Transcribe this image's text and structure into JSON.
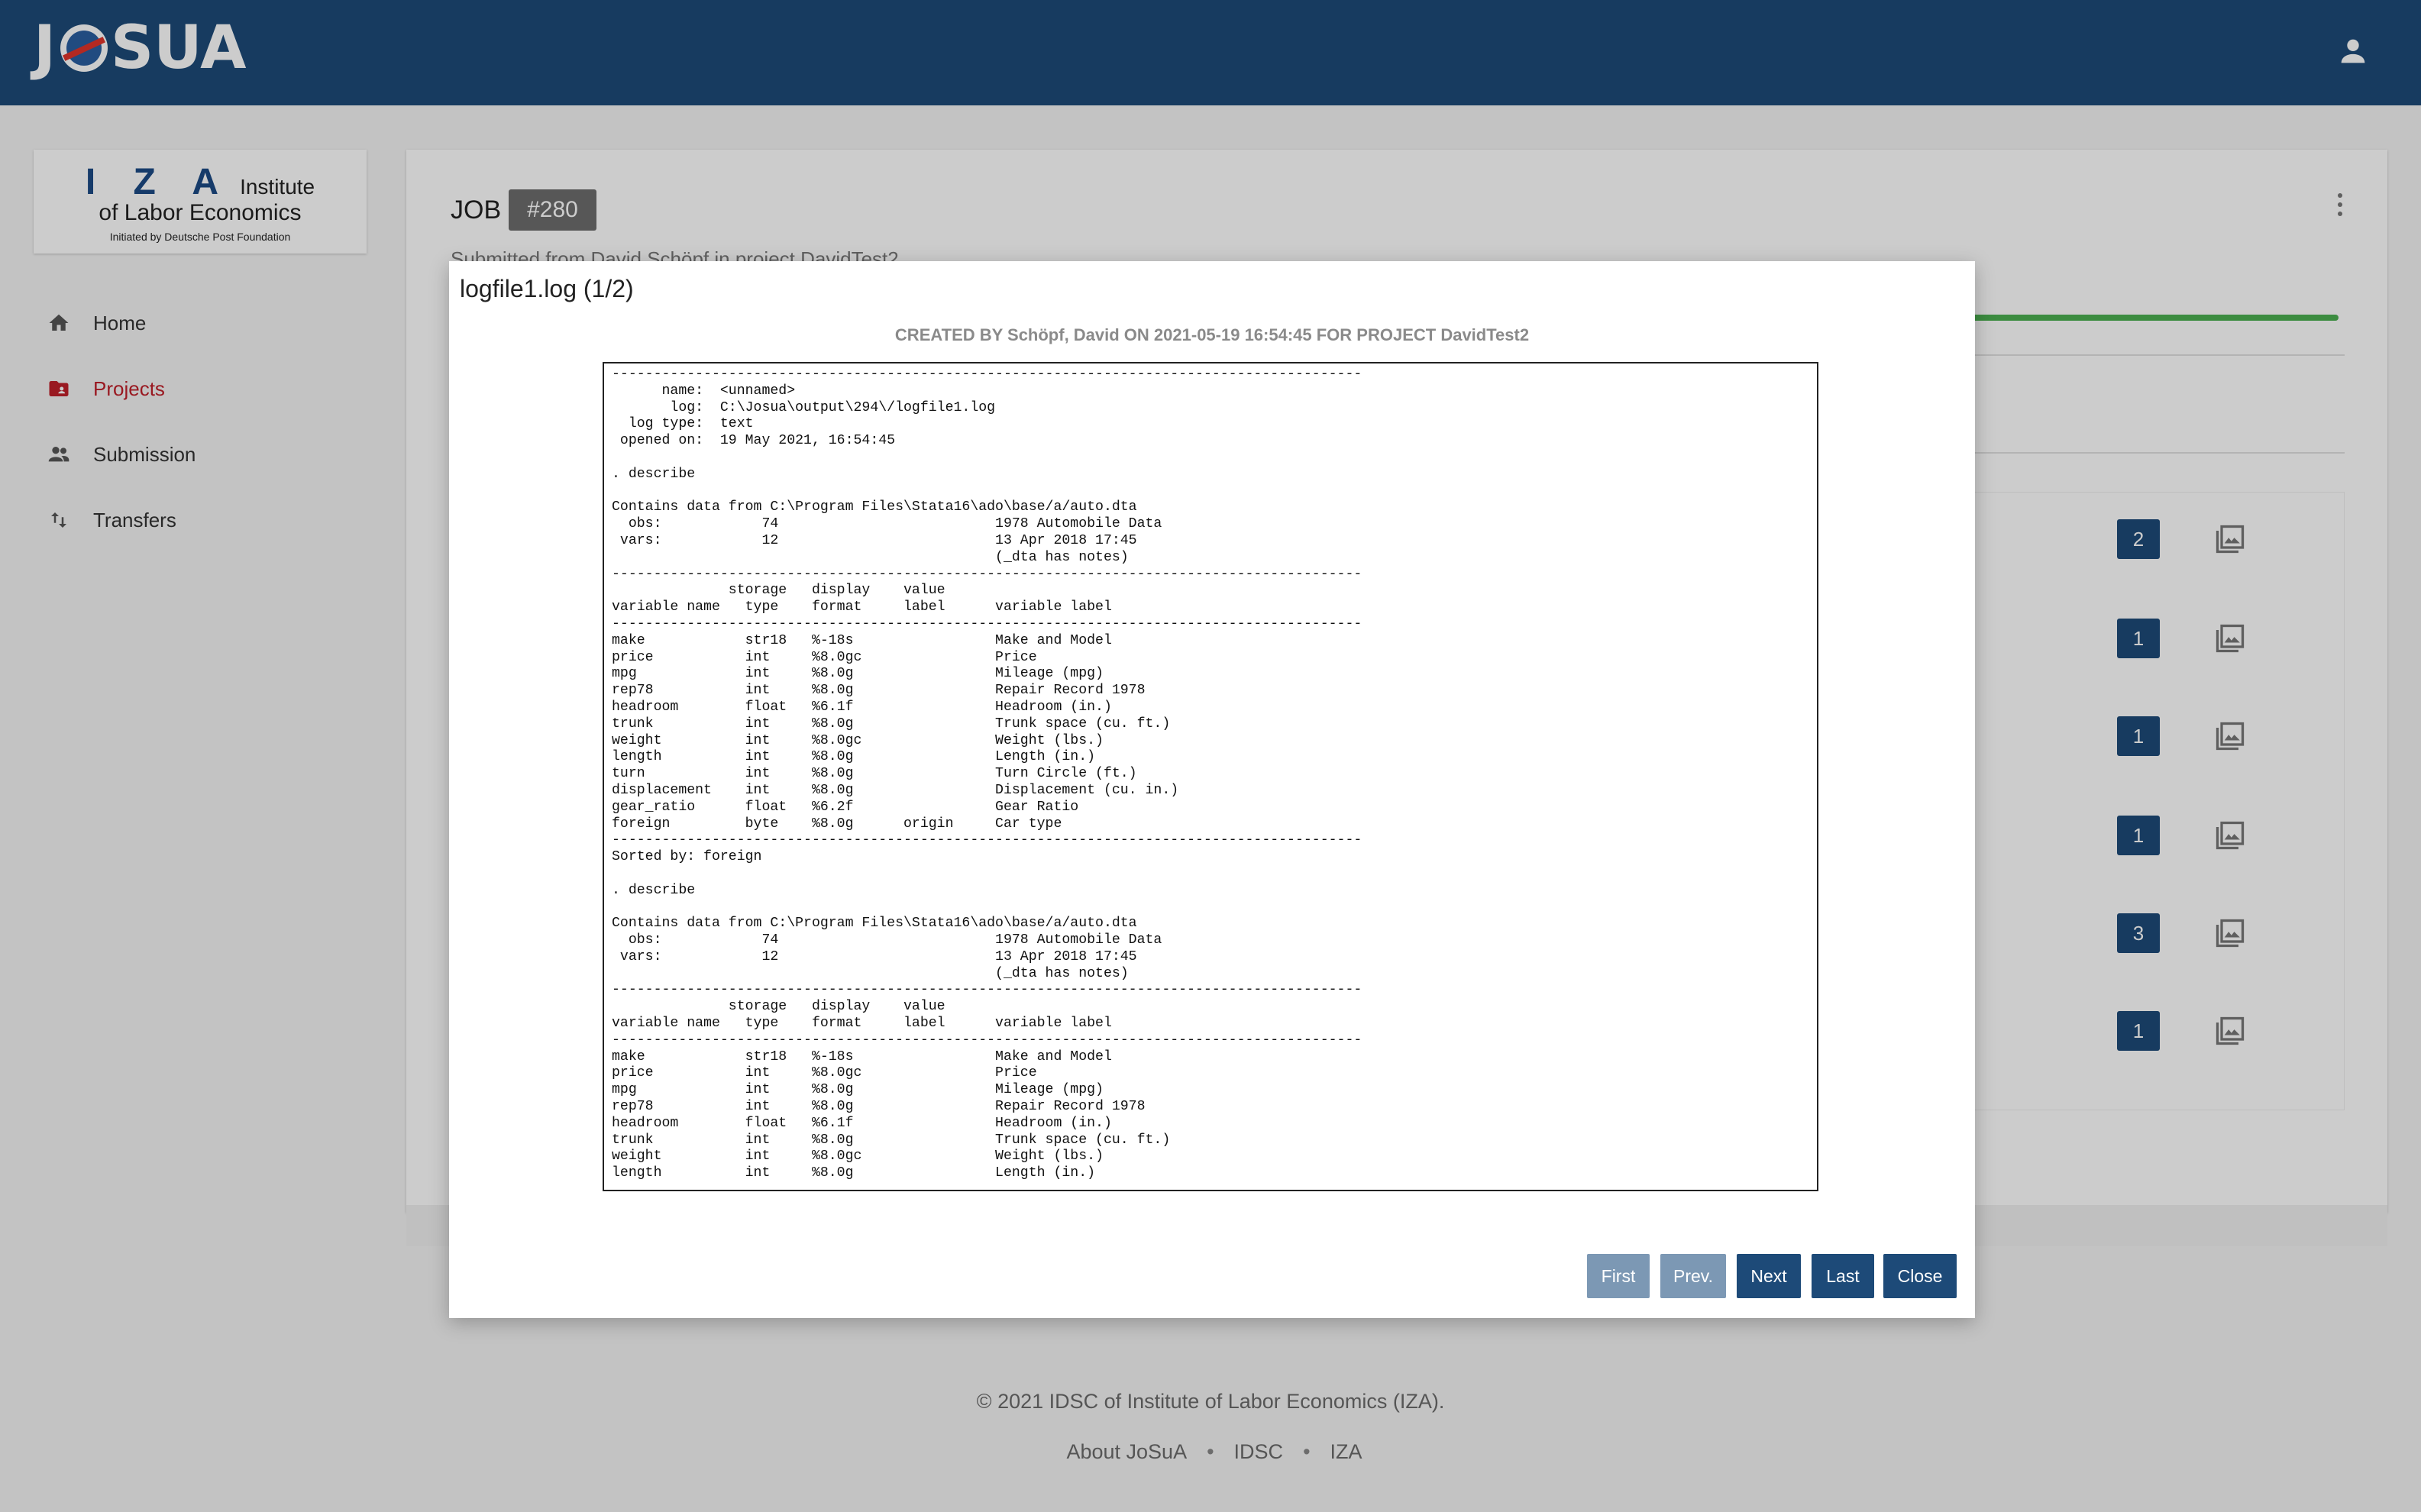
{
  "app": {
    "logo_text_left": "J",
    "logo_text_right": "SUA"
  },
  "sidebar": {
    "org": {
      "letters": "I Z A",
      "line1": "Institute",
      "line2": "of Labor Economics",
      "tagline": "Initiated by Deutsche Post Foundation"
    },
    "items": [
      {
        "label": "Home",
        "icon": "home-icon"
      },
      {
        "label": "Projects",
        "icon": "folder-icon"
      },
      {
        "label": "Submission",
        "icon": "people-icon"
      },
      {
        "label": "Transfers",
        "icon": "transfer-icon"
      }
    ]
  },
  "job": {
    "label": "JOB",
    "number": "#280",
    "subtitle": "Submitted from David Schöpf in project DavidTest2",
    "row_counts": [
      "2",
      "1",
      "1",
      "1",
      "3",
      "1"
    ]
  },
  "modal": {
    "title": "logfile1.log (1/2)",
    "header": "CREATED BY Schöpf, David ON 2021-05-19 16:54:45 FOR PROJECT DavidTest2",
    "log_lines": [
      "------------------------------------------------------------------------------------------",
      "      name:  <unnamed>",
      "       log:  C:\\Josua\\output\\294\\/logfile1.log",
      "  log type:  text",
      " opened on:  19 May 2021, 16:54:45",
      "",
      ". describe",
      "",
      "Contains data from C:\\Program Files\\Stata16\\ado\\base/a/auto.dta",
      "  obs:            74                          1978 Automobile Data",
      " vars:            12                          13 Apr 2018 17:45",
      "                                              (_dta has notes)",
      "------------------------------------------------------------------------------------------",
      "              storage   display    value",
      "variable name   type    format     label      variable label",
      "------------------------------------------------------------------------------------------",
      "make            str18   %-18s                 Make and Model",
      "price           int     %8.0gc                Price",
      "mpg             int     %8.0g                 Mileage (mpg)",
      "rep78           int     %8.0g                 Repair Record 1978",
      "headroom        float   %6.1f                 Headroom (in.)",
      "trunk           int     %8.0g                 Trunk space (cu. ft.)",
      "weight          int     %8.0gc                Weight (lbs.)",
      "length          int     %8.0g                 Length (in.)",
      "turn            int     %8.0g                 Turn Circle (ft.)",
      "displacement    int     %8.0g                 Displacement (cu. in.)",
      "gear_ratio      float   %6.2f                 Gear Ratio",
      "foreign         byte    %8.0g      origin     Car type",
      "------------------------------------------------------------------------------------------",
      "Sorted by: foreign",
      "",
      ". describe",
      "",
      "Contains data from C:\\Program Files\\Stata16\\ado\\base/a/auto.dta",
      "  obs:            74                          1978 Automobile Data",
      " vars:            12                          13 Apr 2018 17:45",
      "                                              (_dta has notes)",
      "------------------------------------------------------------------------------------------",
      "              storage   display    value",
      "variable name   type    format     label      variable label",
      "------------------------------------------------------------------------------------------",
      "make            str18   %-18s                 Make and Model",
      "price           int     %8.0gc                Price",
      "mpg             int     %8.0g                 Mileage (mpg)",
      "rep78           int     %8.0g                 Repair Record 1978",
      "headroom        float   %6.1f                 Headroom (in.)",
      "trunk           int     %8.0g                 Trunk space (cu. ft.)",
      "weight          int     %8.0gc                Weight (lbs.)",
      "length          int     %8.0g                 Length (in.)"
    ],
    "buttons": {
      "first": "First",
      "prev": "Prev.",
      "next": "Next",
      "last": "Last",
      "close": "Close"
    }
  },
  "footer": {
    "copyright": "© 2021 IDSC of Institute of Labor Economics (IZA).",
    "links": [
      "About JoSuA",
      "IDSC",
      "IZA"
    ],
    "separator": "•"
  },
  "colors": {
    "topbar": "#1d4a78",
    "active_nav": "#c0202a",
    "progress": "#4caf50",
    "button_primary": "#1d4a78",
    "button_disabled": "#7c98b4"
  }
}
